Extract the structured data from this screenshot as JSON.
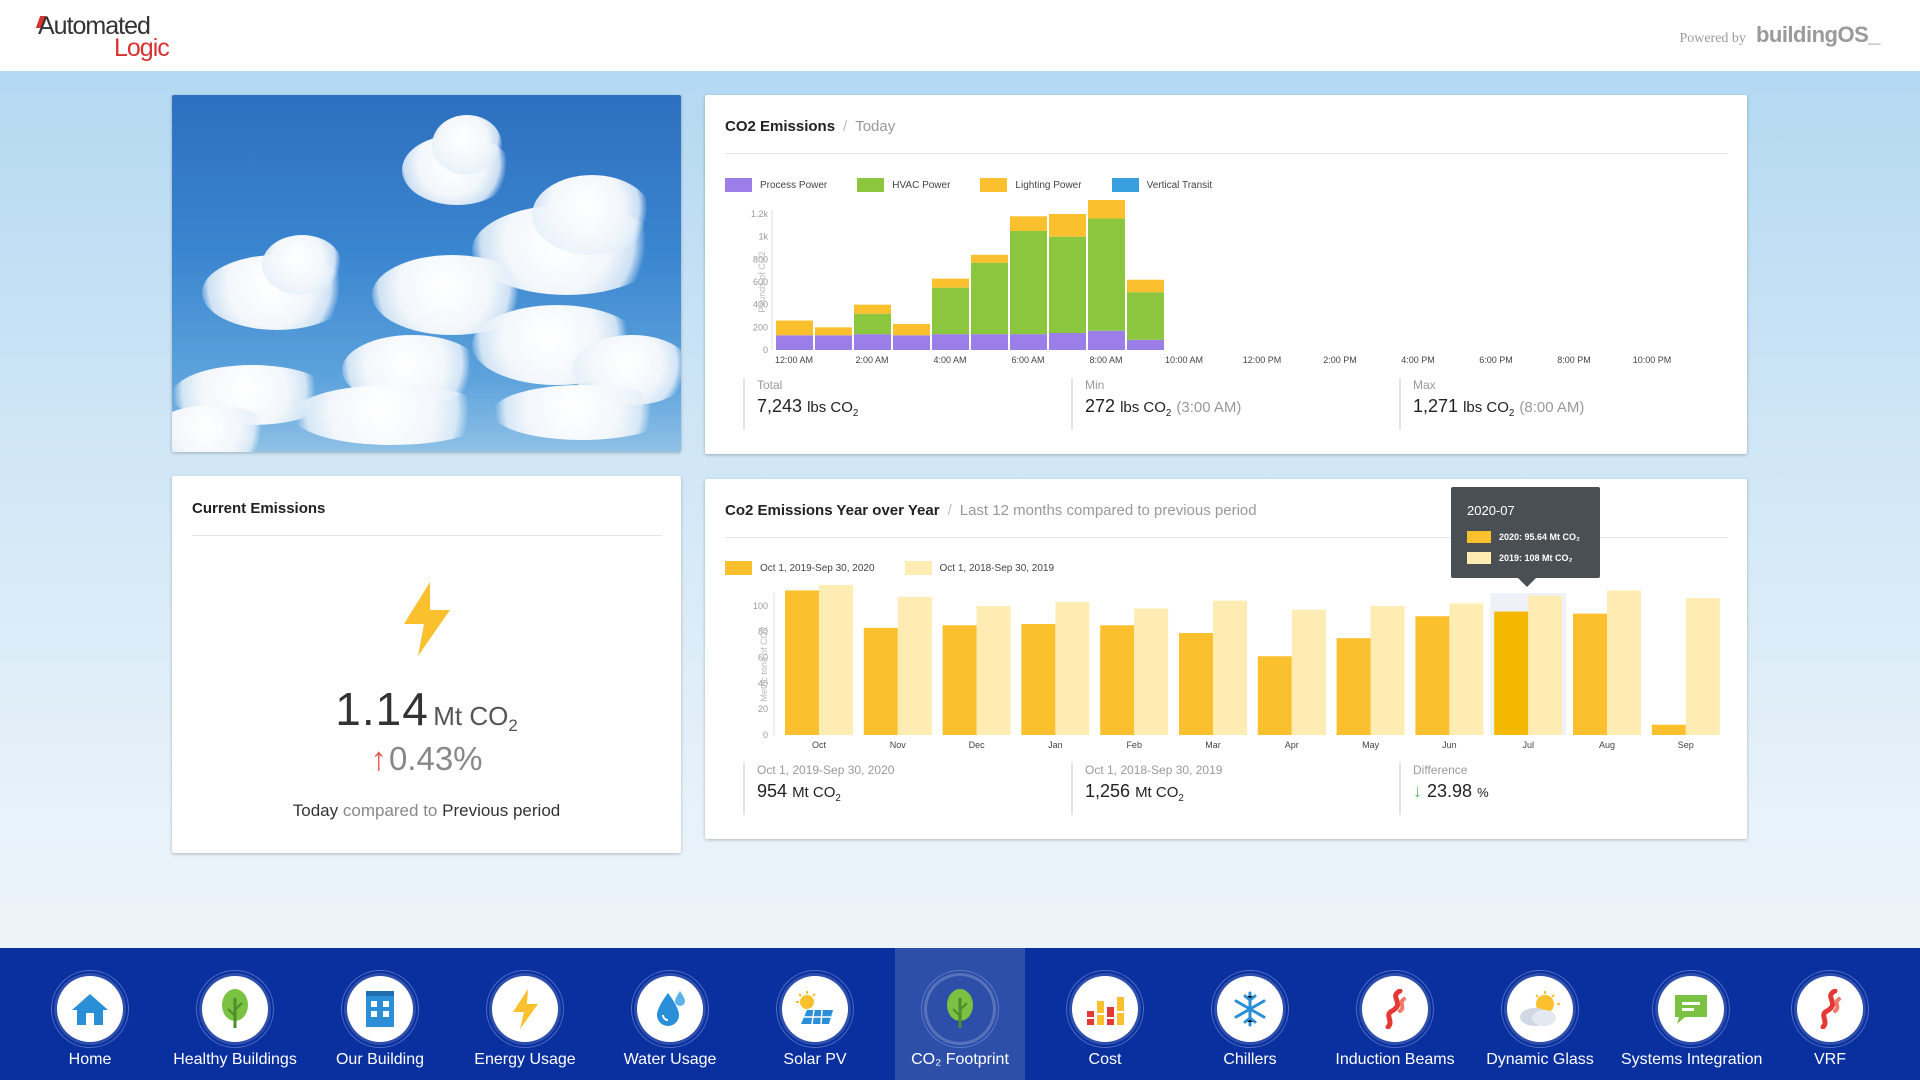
{
  "header": {
    "logo_line1": "Automated",
    "logo_line2": "Logic",
    "powered_by": "Powered by",
    "brand": "buildingOS_"
  },
  "co2_today": {
    "title": "CO2 Emissions",
    "subtitle": "Today",
    "legend": [
      {
        "label": "Process Power",
        "color": "#9b7ee8"
      },
      {
        "label": "HVAC Power",
        "color": "#8cc63f"
      },
      {
        "label": "Lighting Power",
        "color": "#fbc02d"
      },
      {
        "label": "Vertical Transit",
        "color": "#39a0e0"
      }
    ],
    "stats": {
      "total_label": "Total",
      "total_value": "7,243",
      "total_unit": "lbs CO",
      "min_label": "Min",
      "min_value": "272",
      "min_unit": "lbs CO",
      "min_time": "(3:00 AM)",
      "max_label": "Max",
      "max_value": "1,271",
      "max_unit": "lbs CO",
      "max_time": "(8:00 AM)"
    }
  },
  "current": {
    "title": "Current Emissions",
    "value": "1.14",
    "unit": "Mt CO",
    "change": "0.43%",
    "compare_a": "Today",
    "compare_mid": "compared to",
    "compare_b": "Previous period"
  },
  "yoy": {
    "title": "Co2 Emissions Year over Year",
    "subtitle": "Last 12 months compared to previous period",
    "legend": [
      {
        "label": "Oct 1, 2019-Sep 30, 2020",
        "color": "#fbc02d"
      },
      {
        "label": "Oct 1, 2018-Sep 30, 2019",
        "color": "#ffecb3"
      }
    ],
    "tooltip": {
      "title": "2020-07",
      "row1": "2020: 95.64 Mt CO₂",
      "row2": "2019: 108 Mt CO₂"
    },
    "stats": {
      "a_label": "Oct 1, 2019-Sep 30, 2020",
      "a_value": "954",
      "a_unit": "Mt CO",
      "b_label": "Oct 1, 2018-Sep 30, 2019",
      "b_value": "1,256",
      "b_unit": "Mt CO",
      "diff_label": "Difference",
      "diff_value": "23.98",
      "diff_unit": "%"
    }
  },
  "nav": {
    "items": [
      {
        "label": "Home",
        "icon": "home-icon"
      },
      {
        "label": "Healthy Buildings",
        "icon": "tree-icon"
      },
      {
        "label": "Our Building",
        "icon": "building-icon"
      },
      {
        "label": "Energy Usage",
        "icon": "bolt-icon"
      },
      {
        "label": "Water Usage",
        "icon": "water-drop-icon"
      },
      {
        "label": "Solar PV",
        "icon": "solar-panel-icon"
      },
      {
        "label": "CO₂ Footprint",
        "icon": "leaf-icon"
      },
      {
        "label": "Cost",
        "icon": "bar-chart-icon"
      },
      {
        "label": "Chillers",
        "icon": "snowflake-icon"
      },
      {
        "label": "Induction Beams",
        "icon": "heat-flow-icon"
      },
      {
        "label": "Dynamic Glass",
        "icon": "sun-cloud-icon"
      },
      {
        "label": "Systems Integration",
        "icon": "chat-icon"
      },
      {
        "label": "VRF",
        "icon": "heat-flow-icon"
      }
    ],
    "active": "CO₂ Footprint"
  },
  "chart_data": [
    {
      "type": "bar",
      "stacked": true,
      "title": "CO2 Emissions",
      "ylabel": "Pounds of CO2",
      "ylim": [
        0,
        1200
      ],
      "yticks": [
        "0",
        "200",
        "400",
        "600",
        "800",
        "1k",
        "1.2k"
      ],
      "xticks": [
        "12:00 AM",
        "2:00 AM",
        "4:00 AM",
        "6:00 AM",
        "8:00 AM",
        "10:00 AM",
        "12:00 PM",
        "2:00 PM",
        "4:00 PM",
        "6:00 PM",
        "8:00 PM",
        "10:00 PM"
      ],
      "x": [
        "12 AM",
        "1 AM",
        "2 AM",
        "3 AM",
        "4 AM",
        "5 AM",
        "6 AM",
        "7 AM",
        "8 AM",
        "9 AM"
      ],
      "series": [
        {
          "name": "Process Power",
          "values": [
            130,
            130,
            140,
            130,
            140,
            140,
            140,
            150,
            170,
            90
          ]
        },
        {
          "name": "HVAC Power",
          "values": [
            0,
            0,
            180,
            0,
            410,
            630,
            910,
            850,
            990,
            420
          ]
        },
        {
          "name": "Lighting Power",
          "values": [
            130,
            70,
            80,
            100,
            80,
            70,
            130,
            200,
            250,
            110
          ]
        },
        {
          "name": "Vertical Transit",
          "values": [
            0,
            0,
            0,
            0,
            0,
            0,
            0,
            0,
            0,
            0
          ]
        }
      ]
    },
    {
      "type": "bar",
      "title": "Co2 Emissions Year over Year",
      "ylabel": "Metric tons of CO2",
      "ylim": [
        0,
        110
      ],
      "yticks": [
        "0",
        "20",
        "40",
        "60",
        "80",
        "100"
      ],
      "categories": [
        "Oct",
        "Nov",
        "Dec",
        "Jan",
        "Feb",
        "Mar",
        "Apr",
        "May",
        "Jun",
        "Jul",
        "Aug",
        "Sep"
      ],
      "series": [
        {
          "name": "Oct 1, 2019-Sep 30, 2020",
          "values": [
            112,
            83,
            85,
            86,
            85,
            79,
            61,
            75,
            92,
            95.64,
            94,
            8
          ]
        },
        {
          "name": "Oct 1, 2018-Sep 30, 2019",
          "values": [
            118,
            107,
            100,
            103,
            98,
            104,
            97,
            100,
            102,
            108,
            112,
            106
          ]
        }
      ],
      "highlight": "Jul"
    }
  ]
}
